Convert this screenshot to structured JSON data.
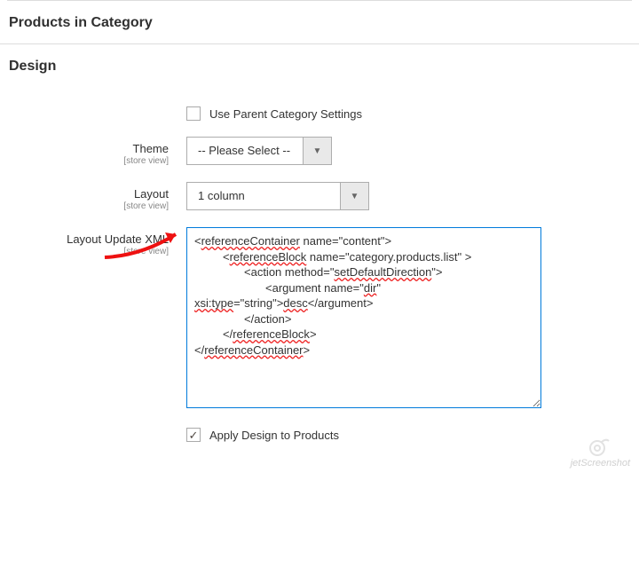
{
  "sections": {
    "products": {
      "title": "Products in Category"
    },
    "design": {
      "title": "Design"
    }
  },
  "fields": {
    "useParent": {
      "label": "Use Parent Category Settings",
      "checked": false
    },
    "theme": {
      "label": "Theme",
      "scope": "[store view]",
      "value": "-- Please Select --"
    },
    "layout": {
      "label": "Layout",
      "scope": "[store view]",
      "value": "1 column"
    },
    "layoutXml": {
      "label": "Layout Update XML",
      "scope": "[store view]",
      "lines": {
        "l1_a": "<",
        "l1_b": "referenceContainer",
        "l1_c": " name=\"content\">",
        "l2_a": "<",
        "l2_b": "referenceBlock",
        "l2_c": " name=\"category.products.list\" >",
        "l3_a": "<action method=\"",
        "l3_b": "setDefaultDirection",
        "l3_c": "\">",
        "l4_a": "<argument name=\"",
        "l4_b": "dir",
        "l4_c": "\"",
        "l5_a": "xsi:type",
        "l5_b": "=\"string\">",
        "l5_c": "desc",
        "l5_d": "</argument>",
        "l6": "</action>",
        "l7_a": "</",
        "l7_b": "referenceBlock",
        "l7_c": ">",
        "l8_a": "</",
        "l8_b": "referenceContainer",
        "l8_c": ">"
      }
    },
    "applyToProducts": {
      "label": "Apply Design to Products",
      "checked": true
    }
  },
  "watermark": "jetScreenshot"
}
